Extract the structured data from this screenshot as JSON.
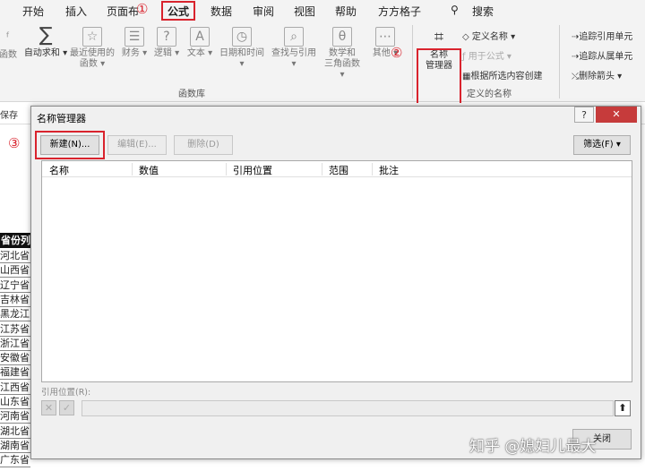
{
  "menu": {
    "items": [
      "开始",
      "插入",
      "页面布",
      "公式",
      "数据",
      "审阅",
      "视图",
      "帮助",
      "方方格子"
    ],
    "search": "搜索",
    "search_icon": "search-icon"
  },
  "markers": {
    "one": "①",
    "two": "②",
    "three": "③"
  },
  "ribbon": {
    "fn_left_partial": "函数",
    "autosum_l1": "自动求和",
    "recent_l1": "最近使用的",
    "recent_l2": "函数",
    "finance": "财务",
    "logic": "逻辑",
    "text": "文本",
    "datetime": "日期和时间",
    "lookup": "查找与引用",
    "math_l1": "数学和",
    "math_l2": "三角函数",
    "other": "其他",
    "group_fnlib": "函数库",
    "namemgr_l1": "名称",
    "namemgr_l2": "管理器",
    "define_name": "定义名称",
    "use_in_formula": "用于公式",
    "create_from_sel": "根据所选内容创建",
    "group_defined": "定义的名称",
    "trace_prec": "追踪引用单元",
    "trace_dep": "追踪从属单元",
    "remove_arrows": "删除箭头",
    "save_partial": "保存"
  },
  "sheet": {
    "header": "省份列",
    "provinces": [
      "河北省",
      "山西省",
      "辽宁省",
      "吉林省",
      "黑龙江",
      "江苏省",
      "浙江省",
      "安徽省",
      "福建省",
      "江西省",
      "山东省",
      "河南省",
      "湖北省",
      "湖南省",
      "广东省"
    ]
  },
  "dialog": {
    "title": "名称管理器",
    "help": "?",
    "close_x": "✕",
    "new_btn": "新建(N)...",
    "edit_btn": "编辑(E)...",
    "delete_btn": "删除(D)",
    "filter_btn": "筛选(F) ▾",
    "cols": [
      "名称",
      "数值",
      "引用位置",
      "范围",
      "批注"
    ],
    "ref_label": "引用位置(R):",
    "cancel_icon": "✕",
    "confirm_icon": "✓",
    "collapse_icon": "⬆",
    "close_btn": "关闭"
  },
  "watermark": "知乎 @媳妇儿最大",
  "colors": {
    "accent_red": "#d9232d",
    "close_red": "#c63b3b",
    "ribbon_bg": "#f3f3f3",
    "dialog_bg": "#f0f0f0"
  }
}
